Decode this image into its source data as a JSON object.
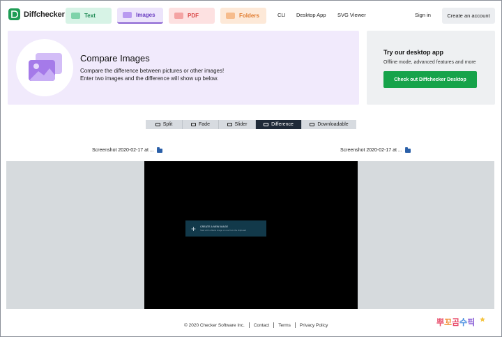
{
  "brand": {
    "name": "Diffchecker"
  },
  "nav": {
    "tabs": [
      {
        "label": "Text",
        "color": "#1f8a55"
      },
      {
        "label": "Images",
        "color": "#6b3fc2"
      },
      {
        "label": "PDF",
        "color": "#d94848"
      },
      {
        "label": "Folders",
        "color": "#e07a2c"
      }
    ],
    "active_tab": "Images",
    "links": [
      "CLI",
      "Desktop App",
      "SVG Viewer"
    ],
    "signin": "Sign in",
    "create_account": "Create an account"
  },
  "hero": {
    "title": "Compare Images",
    "line1": "Compare the difference between pictures or other images!",
    "line2": "Enter two images and the difference will show up below.",
    "icon": "images-icon"
  },
  "promo": {
    "title": "Try our desktop app",
    "subtitle": "Offline mode, advanced features and more",
    "button": "Check out Diffchecker Desktop",
    "button_color": "#16a34a"
  },
  "modes": {
    "items": [
      "Split",
      "Fade",
      "Slider",
      "Difference",
      "Downloadable"
    ],
    "active": "Difference"
  },
  "files": {
    "left": "Screenshot 2020-02-17 at ...",
    "right": "Screenshot 2020-02-17 at ..."
  },
  "diff_image": {
    "title": "CREATE A NEW IMAGE",
    "subtitle": "Start with a blank image or one from the clipboard"
  },
  "footer": {
    "copyright": "© 2020 Checker Software Inc.",
    "contact": "Contact",
    "terms": "Terms",
    "privacy": "Privacy Policy"
  },
  "watermark": {
    "text": "뿌꼬곰수픽"
  }
}
